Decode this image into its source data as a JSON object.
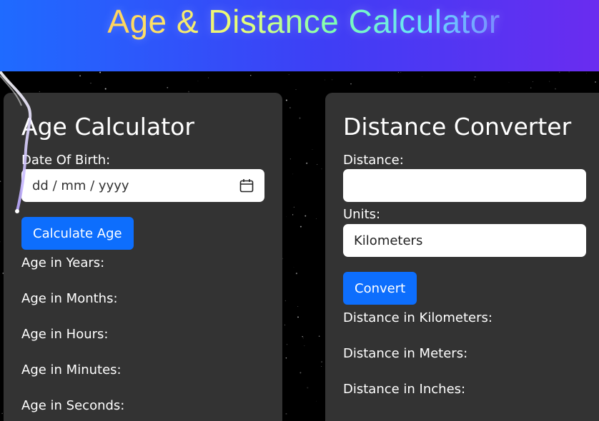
{
  "header": {
    "title": "Age & Distance Calculator"
  },
  "age_calculator": {
    "title": "Age Calculator",
    "dob_label": "Date Of Birth:",
    "dob_placeholder": "dd / mm / yyyy",
    "calendar_icon": "calendar-icon",
    "button_label": "Calculate Age",
    "results": [
      "Age in Years:",
      "Age in Months:",
      "Age in Hours:",
      "Age in Minutes:",
      "Age in Seconds:"
    ]
  },
  "distance_converter": {
    "title": "Distance Converter",
    "distance_label": "Distance:",
    "distance_value": "",
    "units_label": "Units:",
    "units_selected": "Kilometers",
    "button_label": "Convert",
    "results": [
      "Distance in Kilometers:",
      "Distance in Meters:",
      "Distance in Inches:"
    ]
  },
  "colors": {
    "header_start": "#1f6bff",
    "header_end": "#6a2cf0",
    "card_background": "#333333",
    "button": "#0d6efd"
  }
}
